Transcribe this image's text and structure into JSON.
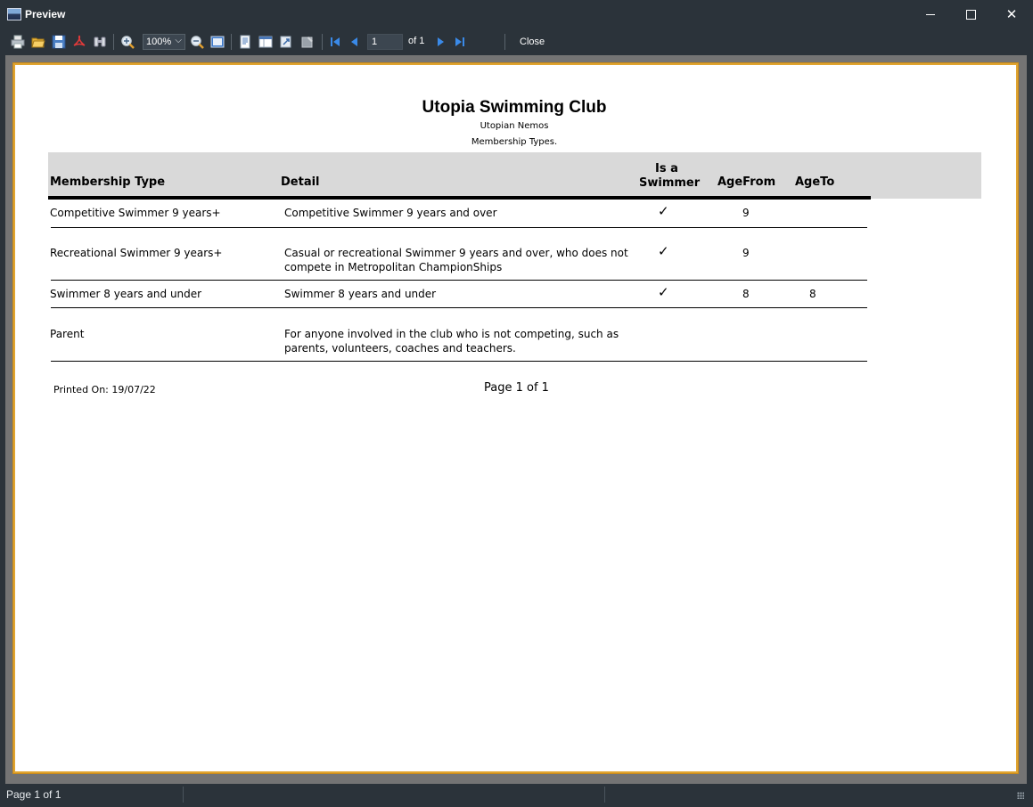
{
  "window": {
    "title": "Preview"
  },
  "toolbar": {
    "icons": [
      "printer-icon",
      "open-folder-icon",
      "save-icon",
      "pdf-icon",
      "binoculars-find-icon",
      "zoom-in-icon",
      "zoom-out-icon",
      "full-page-icon",
      "page-setup-icon",
      "single-page-icon",
      "export-icon",
      "edit-icon",
      "first-page-icon",
      "previous-page-icon",
      "next-page-icon",
      "last-page-icon"
    ],
    "zoom_value": "100%",
    "page_value": "1",
    "page_of": "of 1",
    "close_label": "Close"
  },
  "report": {
    "title": "Utopia Swimming Club",
    "subtitle": "Utopian Nemos",
    "subtitle2": "Membership Types.",
    "columns": {
      "type": "Membership Type",
      "detail": "Detail",
      "swimmer_line1": "Is a",
      "swimmer_line2": "Swimmer",
      "age_from": "AgeFrom",
      "age_to": "AgeTo"
    },
    "rows": [
      {
        "type": "Competitive Swimmer 9 years+",
        "detail1": "Competitive Swimmer 9 years and over",
        "detail2": "",
        "swimmer": "✓",
        "age_from": "9",
        "age_to": ""
      },
      {
        "type": "Recreational Swimmer 9 years+",
        "detail1": "Casual or recreational Swimmer 9 years and over, who does not",
        "detail2": "compete in Metropolitan ChampionShips",
        "swimmer": "✓",
        "age_from": "9",
        "age_to": ""
      },
      {
        "type": "Swimmer 8 years and under",
        "detail1": "Swimmer 8 years and under",
        "detail2": "",
        "swimmer": "✓",
        "age_from": "8",
        "age_to": "8"
      },
      {
        "type": "Parent",
        "detail1": "For anyone involved in the club who is not competing, such as",
        "detail2": "parents, volunteers, coaches and teachers.",
        "swimmer": "",
        "age_from": "",
        "age_to": ""
      }
    ],
    "printed_on": "Printed On: 19/07/22",
    "page_footer": "Page 1 of 1"
  },
  "status": {
    "text": "Page 1 of 1"
  },
  "colors": {
    "chrome": "#2b333a",
    "page_border": "#e0a42f",
    "header_band": "#d9d9d9"
  }
}
